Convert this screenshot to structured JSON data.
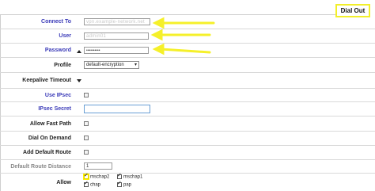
{
  "tab": {
    "label": "Dial Out"
  },
  "fields": {
    "connect_to": {
      "label": "Connect To",
      "value": "vpn.example-network.net"
    },
    "user": {
      "label": "User",
      "value": "admin01"
    },
    "password": {
      "label": "Password",
      "value": "••••••••••"
    },
    "profile": {
      "label": "Profile",
      "value": "default-encryption"
    },
    "keepalive_timeout": {
      "label": "Keepalive Timeout"
    },
    "use_ipsec": {
      "label": "Use IPsec"
    },
    "ipsec_secret": {
      "label": "IPsec Secret",
      "value": ""
    },
    "allow_fast_path": {
      "label": "Allow Fast Path"
    },
    "dial_on_demand": {
      "label": "Dial On Demand"
    },
    "add_default_route": {
      "label": "Add Default Route"
    },
    "default_route_distance": {
      "label": "Default Route Distance",
      "value": "1"
    },
    "allow": {
      "label": "Allow",
      "options": [
        {
          "label": "mschap2",
          "checked": true
        },
        {
          "label": "mschap1",
          "checked": true
        },
        {
          "label": "chap",
          "checked": true
        },
        {
          "label": "pap",
          "checked": true
        }
      ]
    }
  },
  "colors": {
    "highlight": "#f2ef2a",
    "link_label": "#3a3ab8",
    "disabled_label": "#888888"
  }
}
